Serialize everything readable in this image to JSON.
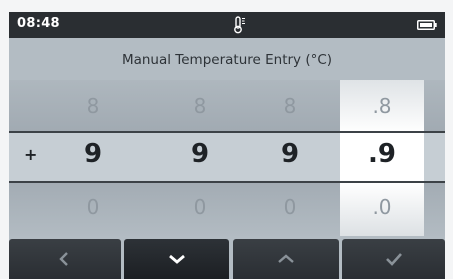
{
  "status_bar": {
    "time": "08:48",
    "center_icon": "thermometer-icon",
    "right_icon": "battery-icon"
  },
  "title": "Manual Temperature Entry (°C)",
  "entry": {
    "sign": "+",
    "columns": [
      {
        "above": "8",
        "value": "9",
        "below": "0"
      },
      {
        "above": "8",
        "value": "9",
        "below": "0"
      },
      {
        "above": "8",
        "value": "9",
        "below": "0"
      },
      {
        "above": ".8",
        "value": ".9",
        "below": ".0"
      }
    ],
    "active_column_index": 3
  },
  "softkeys": [
    {
      "icon": "chevron-left-icon",
      "selected": false
    },
    {
      "icon": "chevron-down-icon",
      "selected": true
    },
    {
      "icon": "chevron-up-icon",
      "selected": false
    },
    {
      "icon": "check-icon",
      "selected": false
    }
  ],
  "colors": {
    "status_bar_bg": "#2a2e32",
    "panel_bg": "#b3bcc3",
    "active_column_bg": "#ffffff",
    "softkey_bg": "#33383d"
  }
}
